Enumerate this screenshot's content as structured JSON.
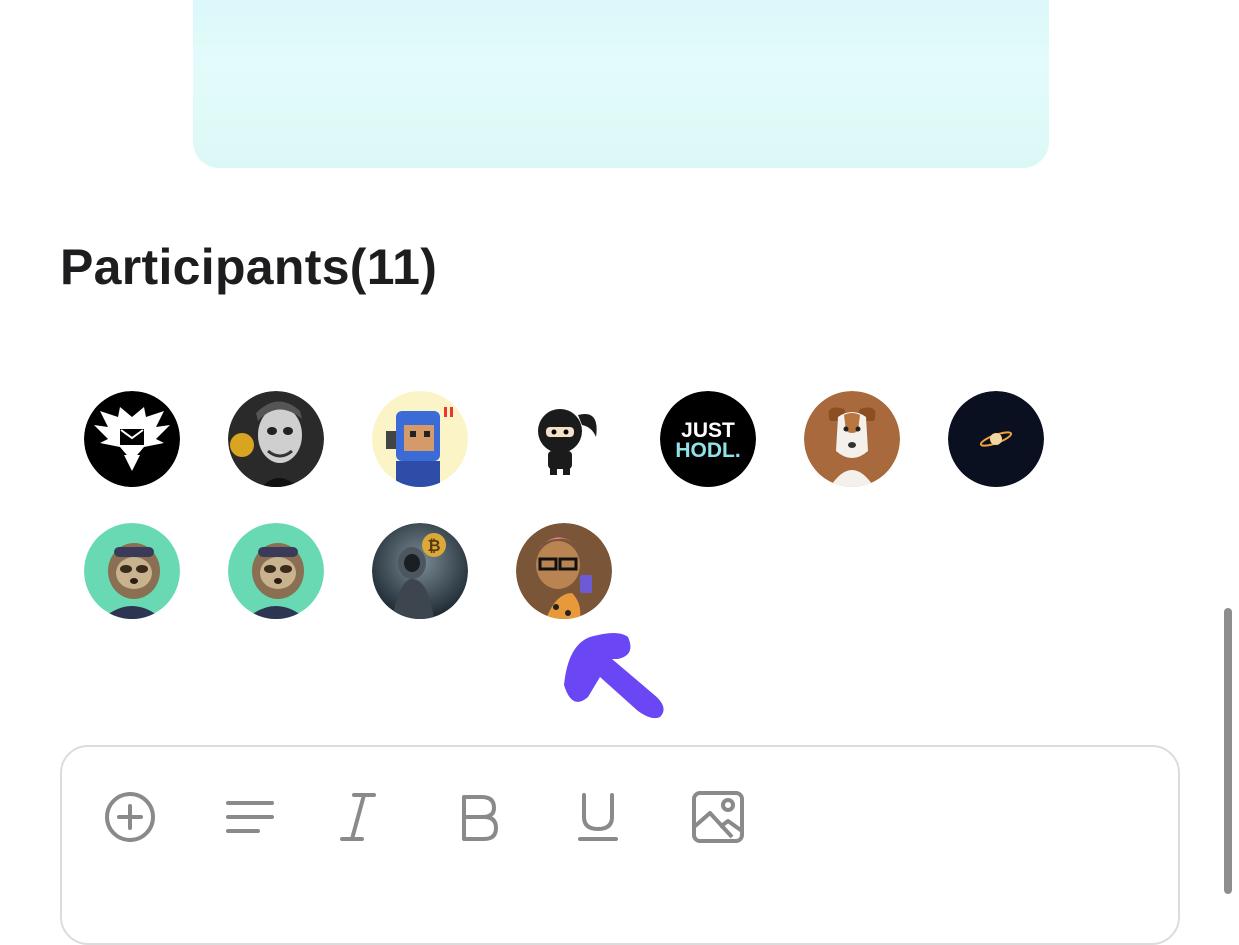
{
  "participants": {
    "title": "Participants(11)",
    "avatars": [
      {
        "name": "eagle-emblem",
        "bg": "#000000"
      },
      {
        "name": "joker",
        "bg": "#2a2a2a"
      },
      {
        "name": "pixel-astronaut",
        "bg": "#fbf4c6"
      },
      {
        "name": "ninja",
        "bg": "#ffffff"
      },
      {
        "name": "just-hodl",
        "bg": "#000000",
        "text": "JUST HODL."
      },
      {
        "name": "dog",
        "bg": "#a86a3c"
      },
      {
        "name": "planet",
        "bg": "#0b1020"
      },
      {
        "name": "sloth-1",
        "bg": "#69d9b3"
      },
      {
        "name": "sloth-2",
        "bg": "#69d9b3"
      },
      {
        "name": "bitcoin-astronaut",
        "bg": "#3b4a55",
        "text": "₿"
      },
      {
        "name": "pink-hair-character",
        "bg": "#7a5538"
      }
    ]
  },
  "brand": {
    "logo": "logo-glyph",
    "color": "#6b46f5"
  },
  "editor": {
    "tools": [
      {
        "name": "add-icon"
      },
      {
        "name": "align-icon"
      },
      {
        "name": "italic-icon"
      },
      {
        "name": "bold-icon"
      },
      {
        "name": "underline-icon"
      },
      {
        "name": "image-icon"
      }
    ],
    "icon_color": "#8a8a8a"
  }
}
